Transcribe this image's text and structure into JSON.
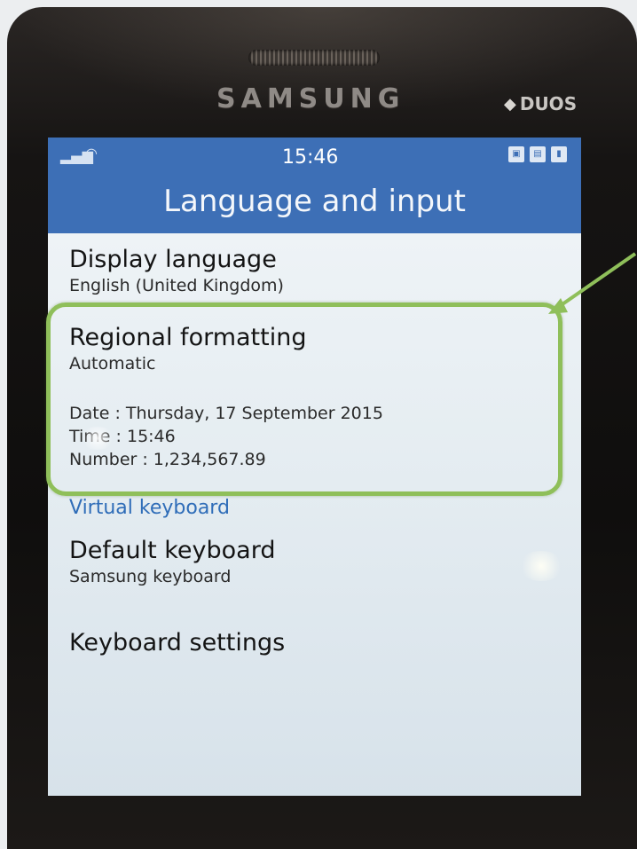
{
  "device": {
    "brand": "SAMSUNG",
    "badge": "DUOS"
  },
  "status_bar": {
    "time": "15:46",
    "icons": [
      "signal-icon",
      "wifi-icon",
      "notification-icon",
      "sim-icon",
      "battery-icon"
    ]
  },
  "header": {
    "title": "Language and input"
  },
  "settings": {
    "display_language": {
      "title": "Display language",
      "value": "English (United Kingdom)"
    },
    "regional_formatting": {
      "title": "Regional formatting",
      "value": "Automatic",
      "date": "Date : Thursday, 17 September 2015",
      "time": "Time : 15:46",
      "number": "Number : 1,234,567.89"
    },
    "virtual_keyboard_header": "Virtual keyboard",
    "default_keyboard": {
      "title": "Default keyboard",
      "value": "Samsung keyboard"
    },
    "keyboard_settings": {
      "title": "Keyboard settings"
    }
  },
  "colors": {
    "header_blue": "#3d6fb6",
    "annotation_green": "#8fbf5a",
    "section_header_blue": "#2f6db8"
  }
}
